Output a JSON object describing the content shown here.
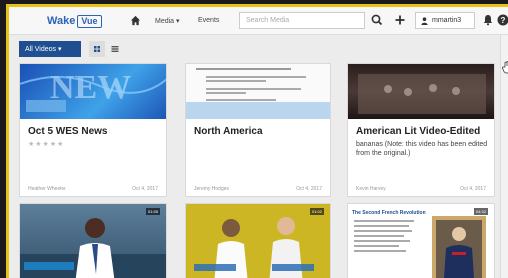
{
  "header": {
    "logo_text": "Wake",
    "logo_badge": "Vue",
    "nav_media": "Media ▾",
    "nav_events": "Events",
    "search_placeholder": "Search Media",
    "user_name": "mmartin3"
  },
  "toolbar": {
    "all_videos_label": "All Videos ▾"
  },
  "cards": [
    {
      "title": "Oct 5 WES News",
      "stars": "★★★★★",
      "author": "Heather Wheeler",
      "date": "Oct 4, 2017",
      "thumb_text": "NEW"
    },
    {
      "title": "North America",
      "author": "Jeremy Hodges",
      "date": "Oct 4, 2017"
    },
    {
      "title": "American Lit Video-Edited",
      "description": "bananas (Note: this video has been edited from the original.)",
      "author": "Kevin Harvey",
      "date": "Oct 4, 2017"
    },
    {
      "duration": "01:55"
    },
    {
      "duration": "01:02"
    },
    {
      "title": "The Second French Revolution",
      "duration": "04:32"
    }
  ],
  "colors": {
    "brand": "#2a63b5",
    "button": "#1f4f91",
    "frame_accent": "#e8c21a"
  },
  "icons": [
    "home-icon",
    "search-icon",
    "plus-icon",
    "user-icon",
    "bell-icon",
    "help-icon",
    "grid-view-icon",
    "list-view-icon",
    "hand-cursor-icon"
  ]
}
